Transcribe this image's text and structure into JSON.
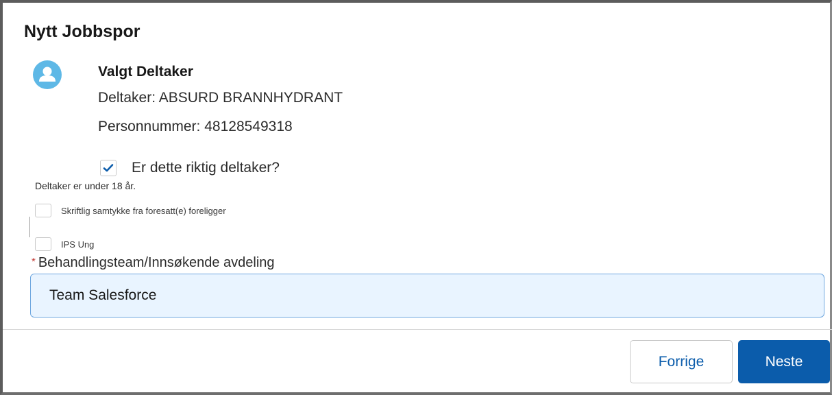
{
  "modal": {
    "title": "Nytt Jobbspor"
  },
  "participant": {
    "avatar_icon": "user-avatar-icon",
    "heading": "Valgt Deltaker",
    "name_line": "Deltaker: ABSURD BRANNHYDRANT",
    "id_line": "Personnummer: 48128549318"
  },
  "confirm": {
    "label": "Er dette riktig deltaker?",
    "checked": true
  },
  "notice": "Deltaker er under 18 år.",
  "options": [
    {
      "label": "Skriftlig samtykke fra foresatt(e) foreligger",
      "checked": false
    },
    {
      "label": "IPS Ung",
      "checked": false
    }
  ],
  "team_field": {
    "required_marker": "*",
    "label": "Behandlingsteam/Innsøkende avdeling",
    "value": "Team Salesforce"
  },
  "footer": {
    "prev_label": "Forrige",
    "next_label": "Neste"
  },
  "colors": {
    "accent": "#0b5cab",
    "avatar": "#5eb8e6",
    "field_bg": "#e9f4ff",
    "required": "#c23934"
  }
}
